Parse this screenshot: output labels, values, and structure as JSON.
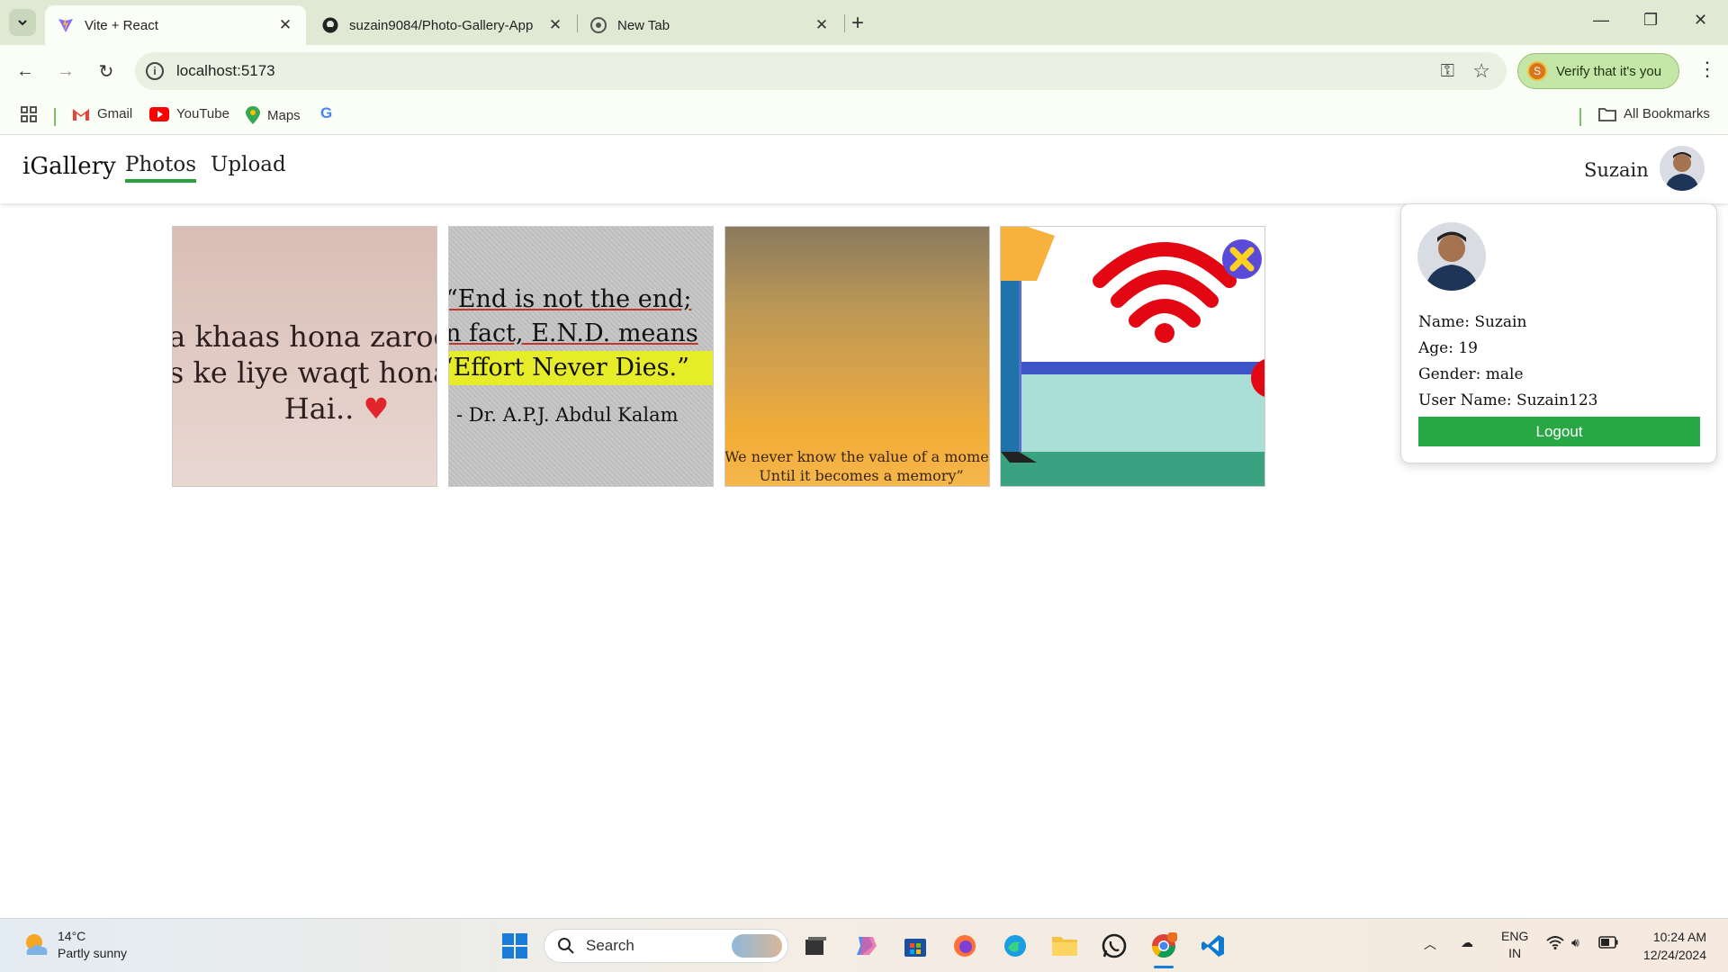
{
  "browser": {
    "tabs": [
      {
        "title": "Vite + React",
        "active": true
      },
      {
        "title": "suzain9084/Photo-Gallery-App",
        "active": false
      },
      {
        "title": "New Tab",
        "active": false
      }
    ],
    "url": "localhost:5173",
    "verify_label": "Verify that it's you",
    "profile_initial": "S",
    "bookmarks": [
      "Gmail",
      "YouTube",
      "Maps"
    ],
    "all_bookmarks": "All Bookmarks"
  },
  "app": {
    "brand": "iGallery",
    "nav": [
      "Photos",
      "Upload"
    ],
    "user_display": "Suzain",
    "accent_color": "#28a745",
    "photos": [
      {
        "lines": [
          "a khaas hona zaroo",
          "s ke liye waqt hona",
          "Hai.."
        ]
      },
      {
        "lines": [
          "“End is not the end;",
          "n fact, E.N.D. means",
          "‘Effort Never Dies.”",
          "- Dr. A.P.J. Abdul Kalam"
        ]
      },
      {
        "lines": [
          "We never know the value of a momen",
          "Until it becomes a memory”"
        ]
      },
      {
        "lines": []
      }
    ],
    "profile": {
      "name_label": "Name: Suzain",
      "age_label": "Age: 19",
      "gender_label": "Gender: male",
      "username_label": "User Name: Suzain123",
      "logout": "Logout"
    }
  },
  "taskbar": {
    "temp": "14°C",
    "weather": "Partly sunny",
    "search": "Search",
    "lang1": "ENG",
    "lang2": "IN",
    "time": "10:24 AM",
    "date": "12/24/2024"
  }
}
